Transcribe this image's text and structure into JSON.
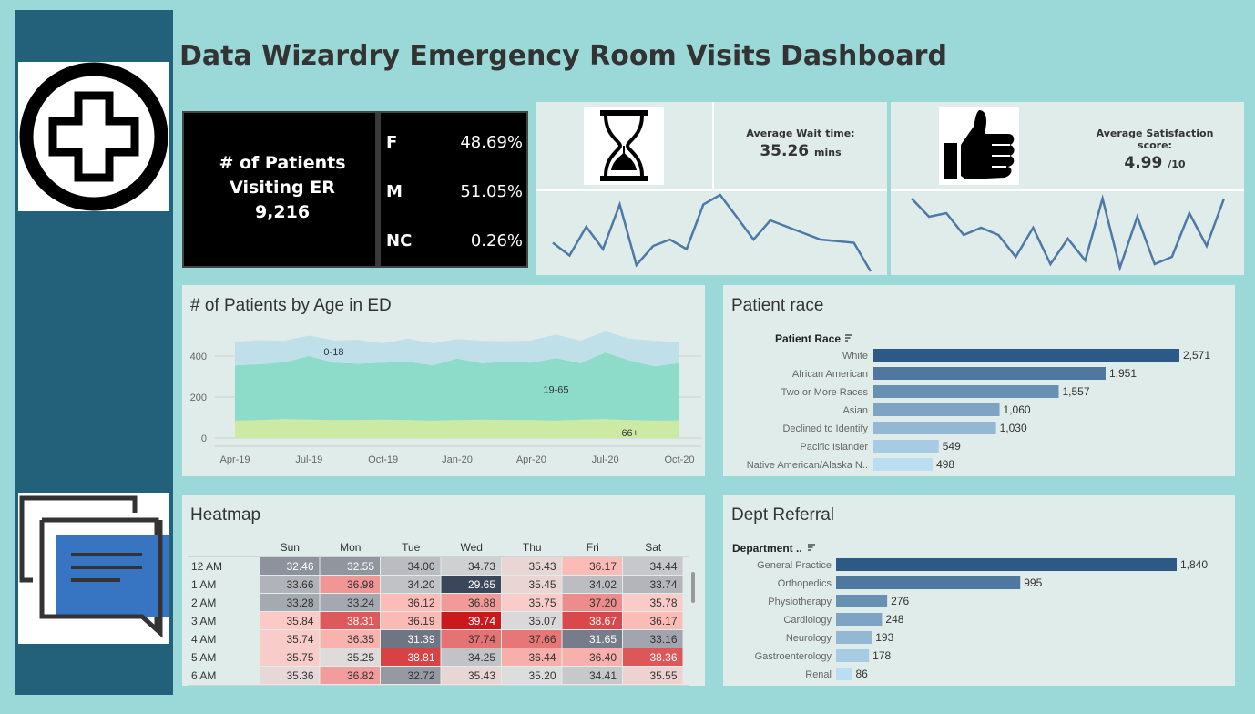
{
  "dashboard": {
    "title": "Data Wizardry Emergency Room Visits Dashboard"
  },
  "icons": [
    "medical-cross-icon",
    "chat-bubbles-icon",
    "hourglass-icon",
    "thumbs-up-icon"
  ],
  "colors": {
    "sidebar": "#23607a",
    "background": "#9bd9d9",
    "panel": "#dfece9",
    "sparkline": "#4e79a7",
    "bar_dark": "#2c5985",
    "bar_light": "#b9ddf1"
  },
  "kpi_patients": {
    "line1": "# of Patients",
    "line2": "Visiting ER",
    "total": "9,216",
    "genders": [
      {
        "code": "F",
        "pct": "48.69%"
      },
      {
        "code": "M",
        "pct": "51.05%"
      },
      {
        "code": "NC",
        "pct": "0.26%"
      }
    ]
  },
  "kpi_wait": {
    "label": "Average Wait time:",
    "value": "35.26",
    "unit": "mins"
  },
  "kpi_satisfaction": {
    "label": "Average Satisfaction score:",
    "value": "4.99",
    "unit": "/10"
  },
  "chart_data": [
    {
      "type": "line",
      "name": "wait-time-sparkline",
      "y": [
        35.1,
        34.7,
        35.6,
        34.9,
        36.3,
        34.4,
        35.0,
        35.2,
        34.9,
        36.3,
        36.6,
        35.9,
        35.2,
        35.8,
        35.6,
        35.4,
        35.2,
        35.15,
        35.1,
        34.2
      ]
    },
    {
      "type": "line",
      "name": "satisfaction-sparkline",
      "y": [
        5.08,
        5.03,
        5.04,
        4.98,
        5.0,
        4.98,
        4.92,
        5.0,
        4.9,
        4.97,
        4.91,
        5.08,
        4.89,
        5.03,
        4.9,
        4.92,
        5.04,
        4.95,
        5.08
      ]
    },
    {
      "type": "area",
      "title": "# of Patients by Age in ED",
      "x": [
        "Apr-19",
        "May-19",
        "Jun-19",
        "Jul-19",
        "Aug-19",
        "Sep-19",
        "Oct-19",
        "Nov-19",
        "Dec-19",
        "Jan-20",
        "Feb-20",
        "Mar-20",
        "Apr-20",
        "May-20",
        "Jun-20",
        "Jul-20",
        "Aug-20",
        "Sep-20",
        "Oct-20"
      ],
      "xticks": [
        "Apr-19",
        "Jul-19",
        "Oct-19",
        "Jan-20",
        "Apr-20",
        "Jul-20",
        "Oct-20"
      ],
      "yticks": [
        0,
        200,
        400
      ],
      "ylim": [
        -40,
        480
      ],
      "series": [
        {
          "name": "66+",
          "values": [
            85,
            88,
            92,
            90,
            88,
            88,
            90,
            88,
            85,
            88,
            90,
            88,
            88,
            85,
            90,
            92,
            88,
            85,
            86
          ]
        },
        {
          "name": "19-65",
          "values": [
            270,
            272,
            278,
            310,
            280,
            275,
            278,
            285,
            270,
            300,
            275,
            285,
            280,
            305,
            275,
            325,
            290,
            265,
            280
          ]
        },
        {
          "name": "0-18",
          "values": [
            115,
            118,
            105,
            100,
            108,
            116,
            95,
            112,
            108,
            95,
            110,
            100,
            108,
            115,
            110,
            103,
            107,
            125,
            103
          ]
        }
      ],
      "series_colors": [
        "#cdeaa5",
        "#8cdcc9",
        "#bfe0e8"
      ]
    },
    {
      "type": "bar",
      "title": "Patient race",
      "field_label": "Patient Race",
      "categories": [
        "White",
        "African American",
        "Two or More Races",
        "Asian",
        "Declined to Identify",
        "Pacific Islander",
        "Native American/Alaska N.."
      ],
      "values": [
        2571,
        1951,
        1557,
        1060,
        1030,
        549,
        498
      ],
      "value_labels": [
        "2,571",
        "1,951",
        "1,557",
        "1,060",
        "1,030",
        "549",
        "498"
      ],
      "xlim": [
        0,
        2571
      ]
    },
    {
      "type": "bar",
      "title": "Dept Referral",
      "field_label": "Department ..",
      "categories": [
        "General Practice",
        "Orthopedics",
        "Physiotherapy",
        "Cardiology",
        "Neurology",
        "Gastroenterology",
        "Renal"
      ],
      "values": [
        1840,
        995,
        276,
        248,
        193,
        178,
        86
      ],
      "value_labels": [
        "1,840",
        "995",
        "276",
        "248",
        "193",
        "178",
        "86"
      ],
      "xlim": [
        0,
        1840
      ]
    },
    {
      "type": "heatmap",
      "title": "Heatmap",
      "columns": [
        "Sun",
        "Mon",
        "Tue",
        "Wed",
        "Thu",
        "Fri",
        "Sat"
      ],
      "rows": [
        "12 AM",
        "1 AM",
        "2 AM",
        "3 AM",
        "4 AM",
        "5 AM",
        "6 AM"
      ],
      "values": [
        [
          32.46,
          32.55,
          34.0,
          34.73,
          35.43,
          36.17,
          34.44
        ],
        [
          33.66,
          36.98,
          34.2,
          29.65,
          35.45,
          34.02,
          33.74
        ],
        [
          33.28,
          33.24,
          36.12,
          36.88,
          35.75,
          37.2,
          35.78
        ],
        [
          35.84,
          38.31,
          36.19,
          39.74,
          35.07,
          38.67,
          36.17
        ],
        [
          35.74,
          36.35,
          31.39,
          37.74,
          37.66,
          31.65,
          33.16
        ],
        [
          35.75,
          35.25,
          38.81,
          34.25,
          36.44,
          36.4,
          38.36
        ],
        [
          35.36,
          36.82,
          32.72,
          35.43,
          35.2,
          34.41,
          35.55
        ]
      ],
      "center": 35.2
    }
  ]
}
